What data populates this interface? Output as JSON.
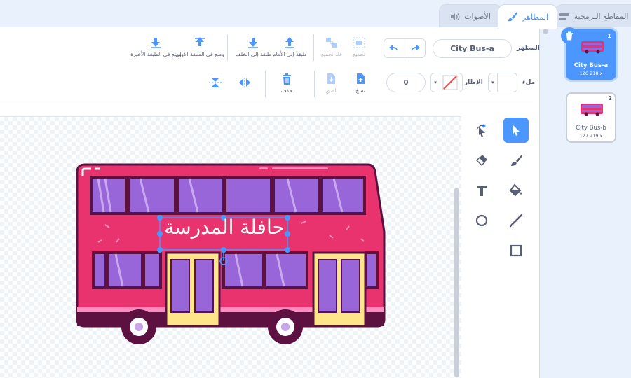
{
  "tabs": [
    {
      "label": "المقاطع البرمجية",
      "icon": "code-blocks-icon"
    },
    {
      "label": "المظاهر",
      "icon": "paintbrush-icon",
      "active": true
    },
    {
      "label": "الأصوات",
      "icon": "speaker-icon"
    }
  ],
  "costume": {
    "label": "المظهر",
    "name": "City Bus-a"
  },
  "toolbar": {
    "group": "تجميع",
    "ungroup": "فك تجميع",
    "forward": "طبقة إلى الأمام",
    "backward": "طبقة إلى الخلف",
    "front": "وضع في الطبقة الأولى",
    "back": "وضع في الطبقة الأخيرة",
    "copy": "نسخ",
    "paste": "لصق",
    "delete": "حذف"
  },
  "style": {
    "fill_label": "ملء",
    "outline_label": "الإطار",
    "outline_width": "0"
  },
  "canvas": {
    "text_object": "حافلة المدرسة"
  },
  "costumes": [
    {
      "index": "1",
      "name": "City Bus-a",
      "size": "126 218 x",
      "selected": true
    },
    {
      "index": "2",
      "name": "City Bus-b",
      "size": "127 219 x",
      "selected": false
    }
  ],
  "colors": {
    "accent": "#4c97ff",
    "bus_body": "#e8336f",
    "window": "#9966d9",
    "door": "#ffe58a",
    "dark": "#5c1140"
  }
}
